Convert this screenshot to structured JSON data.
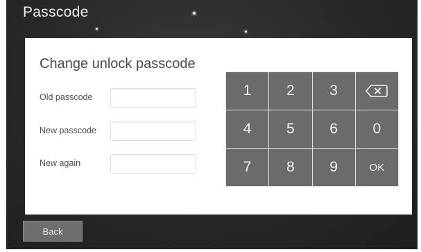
{
  "header": {
    "title": "Passcode"
  },
  "panel": {
    "title": "Change unlock passcode",
    "fields": [
      {
        "label": "Old passcode",
        "value": ""
      },
      {
        "label": "New passcode",
        "value": ""
      },
      {
        "label": "New again",
        "value": ""
      }
    ]
  },
  "keypad": {
    "keys": [
      "1",
      "2",
      "3",
      "backspace",
      "4",
      "5",
      "6",
      "0",
      "7",
      "8",
      "9",
      "OK"
    ],
    "backspace_icon": "backspace-icon"
  },
  "footer": {
    "back_label": "Back"
  },
  "colors": {
    "screen_bg": "#2a2a2a",
    "key_bg": "#6b6b6b",
    "panel_bg": "#ffffff"
  }
}
